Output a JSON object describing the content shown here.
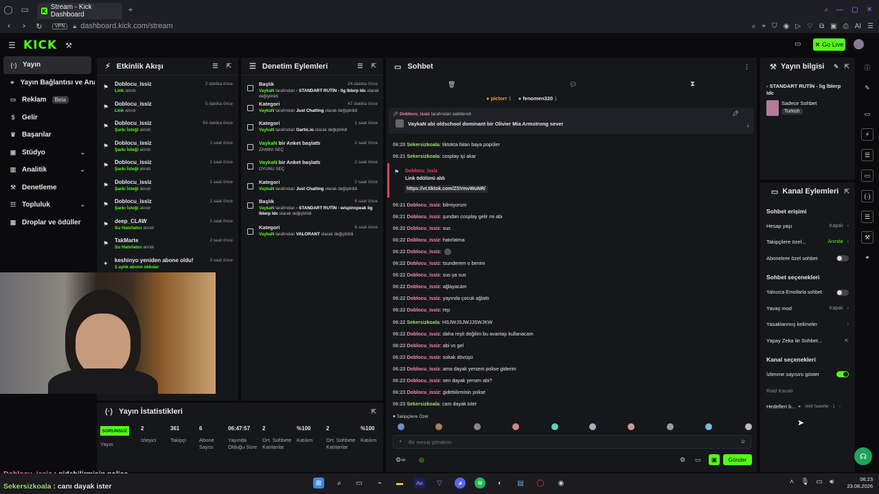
{
  "browser": {
    "tab_title": "Stream - Kick Dashboard",
    "url": "dashboard.kick.com/stream",
    "vpn": "VPN",
    "ai": "AI"
  },
  "header": {
    "logo": "KICK",
    "go_live": "Go Live"
  },
  "sidebar": {
    "items": [
      {
        "label": "Yayın",
        "icon": "broadcast-icon",
        "active": true
      },
      {
        "label": "Yayın Bağlantısı ve Anahtarı",
        "icon": "link-icon"
      },
      {
        "label": "Reklam",
        "icon": "ad-icon",
        "badge": "Beta"
      },
      {
        "label": "Gelir",
        "icon": "dollar-icon"
      },
      {
        "label": "Başarılar",
        "icon": "trophy-icon"
      },
      {
        "label": "Stüdyo",
        "icon": "studio-icon",
        "chevron": true
      },
      {
        "label": "Analitik",
        "icon": "chart-icon",
        "chevron": true
      },
      {
        "label": "Denetleme",
        "icon": "hammer-icon"
      },
      {
        "label": "Topluluk",
        "icon": "community-icon",
        "chevron": true
      },
      {
        "label": "Droplar ve ödüller",
        "icon": "gift-icon"
      }
    ]
  },
  "activity": {
    "title": "Etkinlik Akışı",
    "items": [
      {
        "user": "Doblocu_issiz",
        "action": "Link",
        "rest": "alındı",
        "time": "2 dakika önce"
      },
      {
        "user": "Doblocu_issiz",
        "action": "Link",
        "rest": "alındı",
        "time": "5 dakika önce"
      },
      {
        "user": "Doblocu_issiz",
        "action": "Şarkı İsteği",
        "rest": "alındı",
        "time": "54 dakika önce"
      },
      {
        "user": "Doblocu_issiz",
        "action": "Şarkı İsteği",
        "rest": "alındı",
        "time": "1 saat önce"
      },
      {
        "user": "Doblocu_issiz",
        "action": "Şarkı İsteği",
        "rest": "alındı",
        "time": "1 saat önce"
      },
      {
        "user": "Doblocu_issiz",
        "action": "Şarkı İsteği",
        "rest": "alındı",
        "time": "1 saat önce"
      },
      {
        "user": "Doblocu_issiz",
        "action": "Şarkı İsteği",
        "rest": "alındı",
        "time": "1 saat önce"
      },
      {
        "user": "deep_CLAW",
        "action": "Su Hatırlatıcı",
        "rest": "alındı",
        "time": "1 saat önce"
      },
      {
        "user": "TakMarte",
        "action": "Su Hatırlatıcı",
        "rest": "alındı",
        "time": "2 saat önce"
      },
      {
        "user": "keshinyo yeniden abone oldu!",
        "action": "2 aylık abone oldular",
        "rest": "",
        "time": "3 saat önce"
      }
    ]
  },
  "moderation": {
    "title": "Denetim Eylemleri",
    "items": [
      {
        "title": "Başlık",
        "sub_user": "VaykaN",
        "sub_text": "tarafından",
        "sub_bold": "- STANDART RUTİN - lig lblerp Idc",
        "sub_tail": "olarak değiştirildi",
        "time": "24 dakika önce"
      },
      {
        "title": "Kategori",
        "sub_user": "VaykaN",
        "sub_text": "tarafından",
        "sub_bold": "Just Chatting",
        "sub_tail": "olarak değiştirildi",
        "time": "47 dakika önce"
      },
      {
        "title": "Kategori",
        "sub_user": "VaykaN",
        "sub_text": "tarafından",
        "sub_bold": "Gartic.io",
        "sub_tail": "olarak değiştirildi",
        "time": "1 saat önce"
      },
      {
        "title": "VaykaN bir Anket başlattı",
        "sub_user": "",
        "sub_text": "ZAMINI SEÇ",
        "sub_bold": "",
        "sub_tail": "",
        "time": "2 saat önce"
      },
      {
        "title": "VaykaN bir Anket başlattı",
        "sub_user": "",
        "sub_text": "OYUNU SEÇ",
        "sub_bold": "",
        "sub_tail": "",
        "time": "2 saat önce"
      },
      {
        "title": "Kategori",
        "sub_user": "VaykaN",
        "sub_text": "tarafından",
        "sub_bold": "Just Chatting",
        "sub_tail": "olarak değiştirildi",
        "time": "2 saat önce"
      },
      {
        "title": "Başlık",
        "sub_user": "VaykaN",
        "sub_text": "tarafından",
        "sub_bold": "- STANDART RUTİN - w/spinxpeak lig lblerp Idc",
        "sub_tail": "olarak değiştirildi",
        "time": "6 saat önce"
      },
      {
        "title": "Kategori",
        "sub_user": "VaykaN",
        "sub_text": "tarafından",
        "sub_bold": "VALORANT",
        "sub_tail": "olarak değiştirildi",
        "time": "6 saat önce"
      }
    ]
  },
  "chat": {
    "title": "Sohbet",
    "top_users": [
      {
        "name": "pictorr",
        "count": "1"
      },
      {
        "name": "fenomen320",
        "count": "1"
      }
    ],
    "pinned": {
      "by": "Doblocu_issiz",
      "by_text": "tarafından sabitlendi",
      "text": "VaykaN abi oldschool dominant bir Olivier Mia Armstrong sever"
    },
    "reward": {
      "user": "Doblocu_issiz",
      "text": "Link ödülünü aldı",
      "link": "https://vt.tiktok.com/ZSVmvWuNR/"
    },
    "messages_top": [
      {
        "time": "06:20",
        "user": "Sekersizkoala",
        "msg": "tiktokta falan baya popüler",
        "color": "green"
      },
      {
        "time": "06:21",
        "user": "Sekersizkoala",
        "msg": "cosplay işi akar",
        "color": "green"
      }
    ],
    "messages": [
      {
        "time": "06:21",
        "user": "Doblocu_issiz",
        "msg": "bilmiyorum",
        "color": "pink"
      },
      {
        "time": "06:21",
        "user": "Doblocu_issiz",
        "msg": "şundan cosplay gelir mi abi",
        "color": "pink"
      },
      {
        "time": "06:22",
        "user": "Doblocu_issiz",
        "msg": "sus",
        "color": "pink"
      },
      {
        "time": "06:22",
        "user": "Doblocu_issiz",
        "msg": "hatırlatma",
        "color": "pink"
      },
      {
        "time": "06:22",
        "user": "Doblocu_issiz",
        "msg": "",
        "color": "pink"
      },
      {
        "time": "06:22",
        "user": "Doblocu_issiz",
        "msg": "tsunderem o benim",
        "color": "pink"
      },
      {
        "time": "06:22",
        "user": "Doblocu_issiz",
        "msg": "sus ya sus",
        "color": "pink"
      },
      {
        "time": "06:22",
        "user": "Doblocu_issiz",
        "msg": "ağlayacam",
        "color": "pink"
      },
      {
        "time": "06:22",
        "user": "Doblocu_issiz",
        "msg": "yayında çocuk ağlattı",
        "color": "pink"
      },
      {
        "time": "06:22",
        "user": "Doblocu_issiz",
        "msg": "rep",
        "color": "pink"
      },
      {
        "time": "06:22",
        "user": "Sekersizkoala",
        "msg": "HSJWJSJWJJSWJKW",
        "color": "green"
      },
      {
        "time": "06:22",
        "user": "Doblocu_issiz",
        "msg": "daha reşit değilim bu avantajı kullanacam",
        "color": "pink"
      },
      {
        "time": "06:23",
        "user": "Doblocu_issiz",
        "msg": "abi vs gel",
        "color": "pink"
      },
      {
        "time": "06:23",
        "user": "Doblocu_issiz",
        "msg": "sokak dövüşü",
        "color": "pink"
      },
      {
        "time": "06:23",
        "user": "Doblocu_issiz",
        "msg": "ama dayak yersem polise giderim",
        "color": "pink"
      },
      {
        "time": "06:23",
        "user": "Doblocu_issiz",
        "msg": "sen dayak yersen abi?",
        "color": "pink"
      },
      {
        "time": "06:23",
        "user": "Doblocu_issiz",
        "msg": "gidebilirmisin polise",
        "color": "pink"
      },
      {
        "time": "06:23",
        "user": "Sekersizkoala",
        "msg": "canı dayak ister",
        "color": "green"
      }
    ],
    "followers_only": "Takipçilere Özel",
    "placeholder": "Bir mesaj gönderin",
    "send": "Gönder"
  },
  "stream_info": {
    "title": "Yayın bilgisi",
    "stream_title": "- STANDART RUTİN - lig lblerp Idc",
    "category": "Sadece Sohbet",
    "language": "Turkish"
  },
  "channel_actions": {
    "title": "Kanal Eylemleri",
    "chat_access": "Sohbet erişimi",
    "account_age": {
      "label": "Hesap yaşı",
      "value": "Kapalı"
    },
    "followers_only": {
      "label": "Takipçilere özel...",
      "value": "Anında"
    },
    "subs_only": "Abonelere özel sohbet",
    "chat_options": "Sohbet seçenekleri",
    "emotes_only": "Yalnızca Emotlarla sohbet",
    "slow_mode": {
      "label": "Yavaş mod",
      "value": "Kapalı"
    },
    "banned_words": "Yasaklanmış kelimeler",
    "ai_chat": "Yapay Zeka ile Sohbet...",
    "channel_options": "Kanal seçenekleri",
    "show_viewers": "İzlenme sayısını göster",
    "raid": "Raid Kanalı",
    "goals": {
      "label": "Hedefleri b...",
      "value": "Aktif hedefler - 1"
    }
  },
  "stats": {
    "title": "Yayın İstatistikleri",
    "status": "SORUNSUZ",
    "status_label": "Yayın",
    "items": [
      {
        "value": "2",
        "label": "İzleyici"
      },
      {
        "value": "361",
        "label": "Takipçi"
      },
      {
        "value": "6",
        "label": "Abone Sayısı"
      },
      {
        "value": "06:47:57",
        "label": "Yayında Olduğu Süre"
      },
      {
        "value": "2",
        "label": "Ort. Sohbete Katılanlar"
      },
      {
        "value": "%100",
        "label": "Katılım"
      },
      {
        "value": "2",
        "label": "Ort. Sohbete Katılanlar"
      },
      {
        "value": "%100",
        "label": "Katılım"
      }
    ]
  },
  "overlay": [
    {
      "user": "Doblocu_issiz",
      "msg": "gidebilirmisin polise"
    },
    {
      "user": "Sekersizkoala",
      "msg": "canı dayak ister"
    }
  ],
  "clock": {
    "time": "06:23",
    "date": "23.08.2026"
  },
  "colors": {
    "accent": "#53fc18",
    "pink": "#f88cae",
    "panel": "#16171a"
  }
}
